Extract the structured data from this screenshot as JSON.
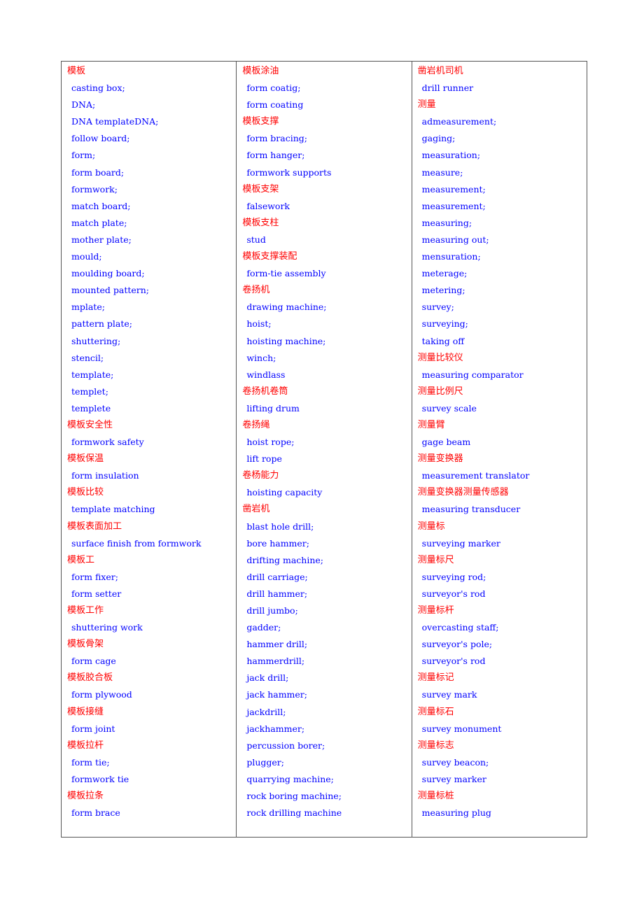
{
  "columns": [
    {
      "entries": [
        {
          "term": "模板",
          "translations": [
            "casting box;",
            "DNA;",
            "DNA templateDNA;",
            "follow board;",
            "form;",
            "form board;",
            "formwork;",
            "match board;",
            "match plate;",
            "mother plate;",
            "mould;",
            "moulding board;",
            "mounted pattern;",
            "mplate;",
            "pattern plate;",
            "shuttering;",
            "stencil;",
            "template;",
            "templet;",
            "templete"
          ]
        },
        {
          "term": "模板安全性",
          "translations": [
            "formwork safety"
          ]
        },
        {
          "term": "模板保温",
          "translations": [
            "form insulation"
          ]
        },
        {
          "term": "模板比较",
          "translations": [
            "template matching"
          ]
        },
        {
          "term": "模板表面加工",
          "translations": [
            "surface finish from formwork"
          ]
        },
        {
          "term": "模板工",
          "translations": [
            "form fixer;",
            "form setter"
          ]
        },
        {
          "term": "模板工作",
          "translations": [
            "shuttering work"
          ]
        },
        {
          "term": "模板骨架",
          "translations": [
            "form cage"
          ]
        },
        {
          "term": "模板胶合板",
          "translations": [
            "form plywood"
          ]
        },
        {
          "term": "模板接缝",
          "translations": [
            "form joint"
          ]
        },
        {
          "term": "模板拉杆",
          "translations": [
            "form tie;",
            "formwork tie"
          ]
        },
        {
          "term": "模板拉条",
          "translations": [
            "form brace"
          ]
        }
      ]
    },
    {
      "entries": [
        {
          "term": "模板涂油",
          "translations": [
            "form coatig;",
            "form coating"
          ]
        },
        {
          "term": "模板支撑",
          "translations": [
            "form bracing;",
            "form hanger;",
            "formwork supports"
          ]
        },
        {
          "term": "模板支架",
          "translations": [
            "falsework"
          ]
        },
        {
          "term": "模板支柱",
          "translations": [
            "stud"
          ]
        },
        {
          "term": "模板支撑装配",
          "translations": [
            "form-tie assembly"
          ]
        },
        {
          "term": "卷扬机",
          "translations": [
            "drawing machine;",
            "hoist;",
            "hoisting machine;",
            "winch;",
            "windlass"
          ]
        },
        {
          "term": "卷扬机卷筒",
          "translations": [
            "lifting drum"
          ]
        },
        {
          "term": "卷扬绳",
          "translations": [
            "hoist rope;",
            "lift rope"
          ]
        },
        {
          "term": "卷杨能力",
          "translations": [
            "hoisting capacity"
          ]
        },
        {
          "term": "凿岩机",
          "translations": [
            "blast hole drill;",
            "bore hammer;",
            "drifting machine;",
            "drill carriage;",
            "drill hammer;",
            "drill jumbo;",
            "gadder;",
            "hammer drill;",
            "hammerdrill;",
            "jack drill;",
            "jack hammer;",
            "jackdrill;",
            "jackhammer;",
            "percussion borer;",
            "plugger;",
            "quarrying machine;",
            "rock boring machine;",
            "rock drilling machine"
          ]
        }
      ]
    },
    {
      "entries": [
        {
          "term": "凿岩机司机",
          "translations": [
            "drill runner"
          ]
        },
        {
          "term": "测量",
          "translations": [
            "admeasurement;",
            "gaging;",
            "measuration;",
            "measure;",
            "measurement;",
            "measurement;",
            "measuring;",
            "measuring out;",
            "mensuration;",
            "meterage;",
            "metering;",
            "survey;",
            "surveying;",
            "taking off"
          ]
        },
        {
          "term": "测量比较仪",
          "translations": [
            "measuring comparator"
          ]
        },
        {
          "term": "测量比例尺",
          "translations": [
            "survey scale"
          ]
        },
        {
          "term": "测量臂",
          "translations": [
            "gage beam"
          ]
        },
        {
          "term": "测量变换器",
          "translations": [
            "measurement translator"
          ]
        },
        {
          "term": "测量变换器测量传感器",
          "translations": [
            "measuring transducer"
          ]
        },
        {
          "term": "测量标",
          "translations": [
            "surveying marker"
          ]
        },
        {
          "term": "测量标尺",
          "translations": [
            "surveying rod;",
            "surveyor's rod"
          ]
        },
        {
          "term": "测量标杆",
          "translations": [
            "overcasting staff;",
            "surveyor's pole;",
            "surveyor's rod"
          ]
        },
        {
          "term": "测量标记",
          "translations": [
            "survey mark"
          ]
        },
        {
          "term": "测量标石",
          "translations": [
            "survey monument"
          ]
        },
        {
          "term": "测量标志",
          "translations": [
            "survey beacon;",
            "survey marker"
          ]
        },
        {
          "term": "测量标桩",
          "translations": [
            "measuring plug"
          ]
        }
      ]
    }
  ],
  "colors": {
    "term": "#ff0000",
    "translation": "#0000ff",
    "border": "#555555"
  }
}
